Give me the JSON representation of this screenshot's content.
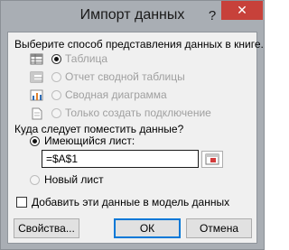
{
  "window": {
    "title": "Импорт данных",
    "help_label": "?",
    "close_label": "✕"
  },
  "view_section": {
    "heading": "Выберите способ представления данных в книге.",
    "options": [
      {
        "label": "Таблица",
        "selected": true,
        "enabled": false,
        "icon": "table-icon"
      },
      {
        "label": "Отчет сводной таблицы",
        "selected": false,
        "enabled": false,
        "icon": "pivot-table-icon"
      },
      {
        "label": "Сводная диаграмма",
        "selected": false,
        "enabled": false,
        "icon": "pivot-chart-icon"
      },
      {
        "label": "Только создать подключение",
        "selected": false,
        "enabled": false,
        "icon": "connection-icon"
      }
    ]
  },
  "location_section": {
    "heading": "Куда следует поместить данные?",
    "existing_sheet_label": "Имеющийся лист:",
    "existing_sheet_selected": true,
    "range_value": "=$A$1",
    "new_sheet_label": "Новый лист",
    "new_sheet_selected": false
  },
  "data_model_checkbox": {
    "label": "Добавить эти данные в модель данных",
    "checked": false
  },
  "buttons": {
    "properties": "Свойства...",
    "ok": "ОК",
    "cancel": "Отмена"
  },
  "colors": {
    "close_button": "#c7413a",
    "default_button_border": "#0078d7",
    "window_frame": "#a9aeb4",
    "client_background": "#f0f0f0"
  }
}
